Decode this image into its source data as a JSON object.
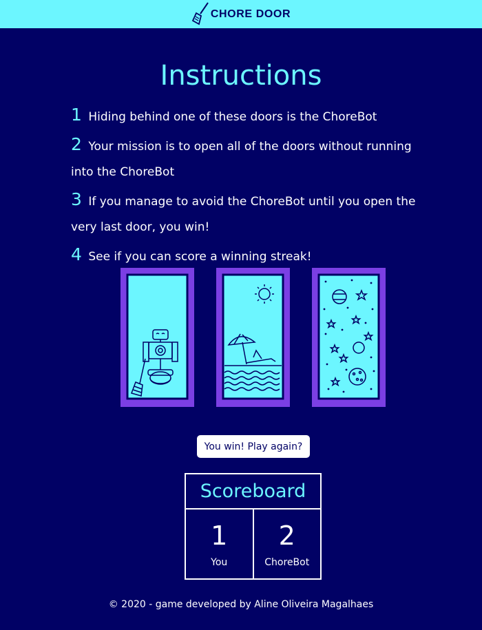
{
  "header": {
    "logo_icon": "broom-icon",
    "title": "CHORE DOOR",
    "colors": {
      "header_bg": "#6cf6ff",
      "page_bg": "#010165",
      "accent": "#6cf6ff",
      "door_frame": "#7b3fe4"
    }
  },
  "instructions": {
    "title": "Instructions",
    "items": [
      {
        "number": "1",
        "text": "Hiding behind one of these doors is the ChoreBot"
      },
      {
        "number": "2",
        "text": "Your mission is to open all of the doors without running into the ChoreBot"
      },
      {
        "number": "3",
        "text": "If you manage to avoid the ChoreBot until you open the very last door, you win!"
      },
      {
        "number": "4",
        "text": "See if you can score a winning streak!"
      }
    ]
  },
  "doors": [
    {
      "content": "robot-icon"
    },
    {
      "content": "beach-icon"
    },
    {
      "content": "space-icon"
    }
  ],
  "game": {
    "play_again_label": "You win! Play again?"
  },
  "scoreboard": {
    "title": "Scoreboard",
    "player_score": "1",
    "player_label": "You",
    "bot_score": "2",
    "bot_label": "ChoreBot"
  },
  "footer": {
    "text": "© 2020 - game developed by Aline Oliveira Magalhaes"
  }
}
